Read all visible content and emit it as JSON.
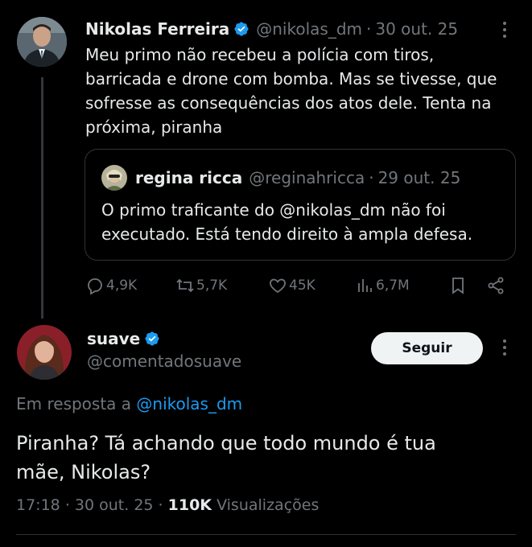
{
  "parent_tweet": {
    "author_name": "Nikolas Ferreira",
    "handle": "@nikolas_dm",
    "separator": "·",
    "date": "30 out. 25",
    "text_lines": [
      "Meu primo não recebeu a polícia com tiros,",
      "barricada e drone com bomba. Mas se tivesse, que",
      "sofresse as consequências dos atos dele. Tenta na",
      "próxima, piranha"
    ],
    "quoted": {
      "author_name": "regina ricca",
      "handle": "@reginahricca",
      "separator": "·",
      "date": "29 out. 25",
      "text_lines": [
        "O primo traficante do @nikolas_dm não foi",
        "executado. Está tendo direito à ampla defesa."
      ]
    },
    "actions": {
      "replies": "4,9K",
      "retweets": "5,7K",
      "likes": "45K",
      "views": "6,7M"
    }
  },
  "reply_tweet": {
    "author_name": "suave",
    "handle": "@comentadosuave",
    "follow_label": "Seguir",
    "reply_context_prefix": "Em resposta a",
    "reply_context_handle": "@nikolas_dm",
    "text_lines": [
      "Piranha? Tá achando que todo mundo é tua",
      "mãe, Nikolas?"
    ],
    "time": "17:18",
    "separator": "·",
    "date": "30 out. 25",
    "views_count": "110K",
    "views_label": "Visualizações"
  },
  "icons": [
    "verified-badge-icon",
    "more-icon",
    "reply-icon",
    "retweet-icon",
    "like-icon",
    "views-icon",
    "bookmark-icon",
    "share-icon"
  ],
  "colors": {
    "background": "#000000",
    "text": "#e7e9ea",
    "muted": "#71767b",
    "accent": "#1d9bf0",
    "border": "#2f3336"
  }
}
